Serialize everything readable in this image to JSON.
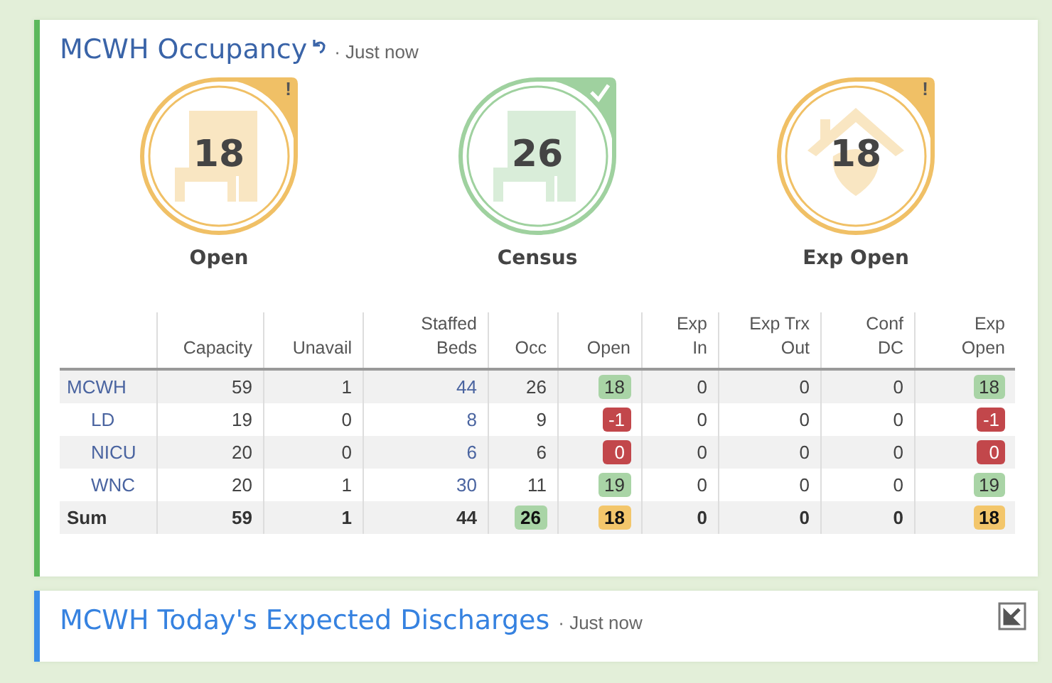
{
  "occupancy_panel": {
    "title": "MCWH Occupancy",
    "updated": "· Just now",
    "tiles": [
      {
        "label": "Open",
        "value": "18",
        "color": "#f0c066",
        "mark": "!",
        "kind": "bed"
      },
      {
        "label": "Census",
        "value": "26",
        "color": "#9fd19f",
        "verified": true,
        "kind": "bed"
      },
      {
        "label": "Exp Open",
        "value": "18",
        "color": "#f0c066",
        "mark": "!",
        "kind": "house"
      }
    ],
    "table": {
      "columns": [
        "Capacity",
        "Unavail",
        "Staffed\nBeds",
        "Occ",
        "Open",
        "Exp\nIn",
        "Exp Trx\nOut",
        "Conf\nDC",
        "Exp\nOpen"
      ],
      "rows": [
        {
          "label": "MCWH",
          "cells": [
            {
              "text": "59"
            },
            {
              "text": "1"
            },
            {
              "text": "44",
              "link": true
            },
            {
              "text": "26"
            },
            {
              "text": "18",
              "color": "#a9d4a6"
            },
            {
              "text": "0"
            },
            {
              "text": "0"
            },
            {
              "text": "0"
            },
            {
              "text": "18",
              "color": "#a9d4a6"
            }
          ],
          "children": [
            {
              "label": "LD",
              "cells": [
                {
                  "text": "19"
                },
                {
                  "text": "0"
                },
                {
                  "text": "8",
                  "link": true
                },
                {
                  "text": "9"
                },
                {
                  "text": "-1",
                  "color": "#c2474b"
                },
                {
                  "text": "0"
                },
                {
                  "text": "0"
                },
                {
                  "text": "0"
                },
                {
                  "text": "-1",
                  "color": "#c2474b"
                }
              ]
            },
            {
              "label": "NICU",
              "cells": [
                {
                  "text": "20"
                },
                {
                  "text": "0"
                },
                {
                  "text": "6",
                  "link": true
                },
                {
                  "text": "6"
                },
                {
                  "text": "0",
                  "color": "#c2474b"
                },
                {
                  "text": "0"
                },
                {
                  "text": "0"
                },
                {
                  "text": "0"
                },
                {
                  "text": "0",
                  "color": "#c2474b"
                }
              ]
            },
            {
              "label": "WNC",
              "cells": [
                {
                  "text": "20"
                },
                {
                  "text": "1"
                },
                {
                  "text": "30",
                  "link": true
                },
                {
                  "text": "11"
                },
                {
                  "text": "19",
                  "color": "#a9d4a6"
                },
                {
                  "text": "0"
                },
                {
                  "text": "0"
                },
                {
                  "text": "0"
                },
                {
                  "text": "19",
                  "color": "#a9d4a6"
                }
              ]
            }
          ]
        },
        {
          "label": "Sum",
          "kind": "total",
          "cells": [
            {
              "text": "59"
            },
            {
              "text": "1"
            },
            {
              "text": "44"
            },
            {
              "text": "26",
              "color": "#a9d4a6"
            },
            {
              "text": "18",
              "color": "#f3c66b"
            },
            {
              "text": "0"
            },
            {
              "text": "0"
            },
            {
              "text": "0"
            },
            {
              "text": "18",
              "color": "#f3c66b"
            }
          ]
        }
      ]
    }
  },
  "discharges_panel": {
    "title": "MCWH Today's Expected Discharges",
    "updated": "· Just now"
  }
}
